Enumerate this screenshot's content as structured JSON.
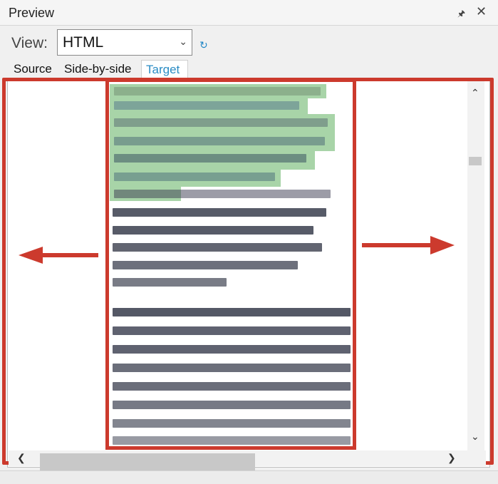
{
  "panel": {
    "title": "Preview",
    "pin_icon": "pin-icon",
    "close_icon": "close-icon",
    "view_label": "View:",
    "view_value": "HTML",
    "tabs": [
      "Source",
      "Side-by-side",
      "Target"
    ],
    "active_tab": "Target"
  },
  "colors": {
    "accent": "#cc3a2d",
    "highlight": "#a8d4a8",
    "tab_active": "#2b8cc4"
  },
  "icons": {
    "dropdown": "chevron-down-icon",
    "refresh": "refresh-icon",
    "scroll_up": "chevron-up-icon",
    "scroll_down": "chevron-down-icon",
    "scroll_left": "chevron-left-icon",
    "scroll_right": "chevron-right-icon",
    "arrow_left": "arrow-left-icon",
    "arrow_right": "arrow-right-icon"
  }
}
